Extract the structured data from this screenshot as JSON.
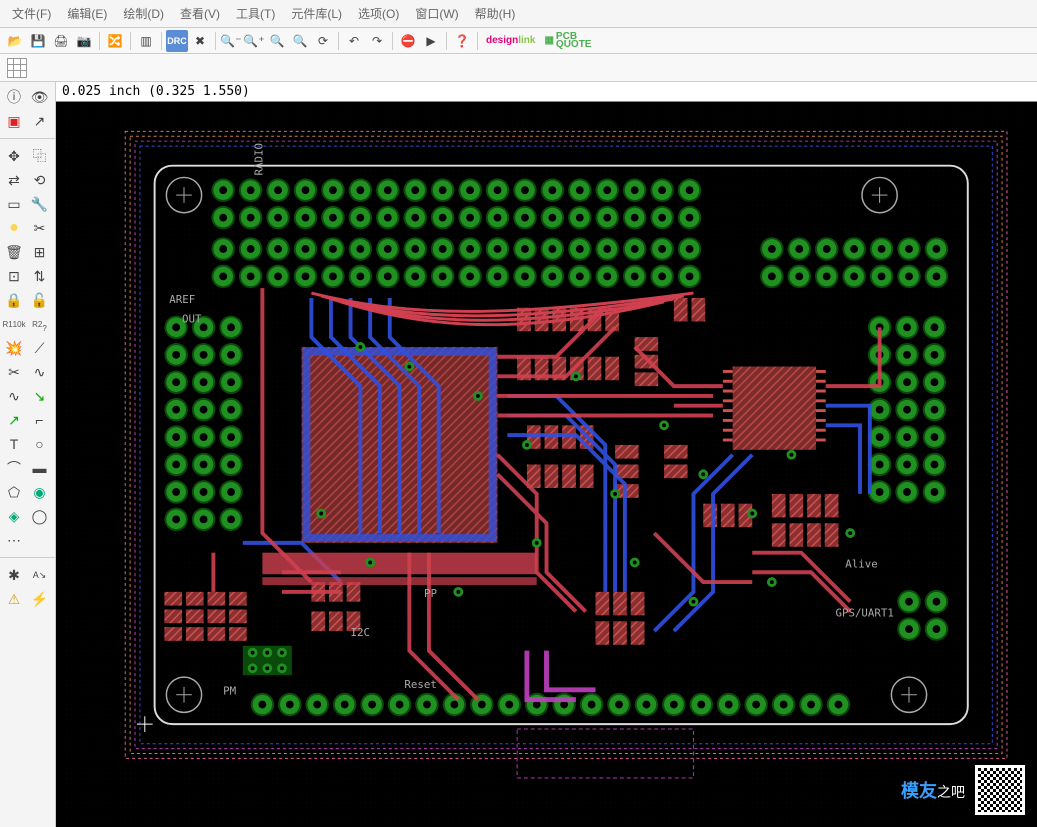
{
  "menu": {
    "file": "文件(F)",
    "edit": "编辑(E)",
    "draw": "绘制(D)",
    "view": "查看(V)",
    "tools": "工具(T)",
    "library": "元件库(L)",
    "options": "选项(O)",
    "window": "窗口(W)",
    "help": "帮助(H)"
  },
  "coord": "0.025  inch  (0.325  1.550)",
  "ext_logos": {
    "design_link_1": "design",
    "design_link_2": "link",
    "pcb_quote_1": "PCB",
    "pcb_quote_2": "QUOTE"
  },
  "left_tools_text": {
    "r1": "R1",
    "r2": "R2",
    "ten_k": "10k"
  },
  "watermark": {
    "brand": "模友",
    "suffix": "之吧"
  },
  "pcb": {
    "labels": {
      "radio": "RADIO",
      "aref": "AREF",
      "out": "OUT",
      "reset": "Reset",
      "i2c": "I2C",
      "alive": "Alive",
      "gps": "GPS/UART1",
      "pm": "PM",
      "pp": "PP"
    },
    "silkscreen_color": "#aaaaaa",
    "layers": {
      "top_copper": "#d04050",
      "bottom_copper": "#3050e0",
      "pads": "#209020",
      "pad_ring_dark": "#0a4a0a",
      "via_purple": "#c040c0",
      "outline_pink": "#e060a0",
      "outline_orange": "#d08040",
      "drill": "#000000",
      "silkscreen": "#d0d0d0",
      "fill_cyan": "#40a0a0"
    }
  }
}
